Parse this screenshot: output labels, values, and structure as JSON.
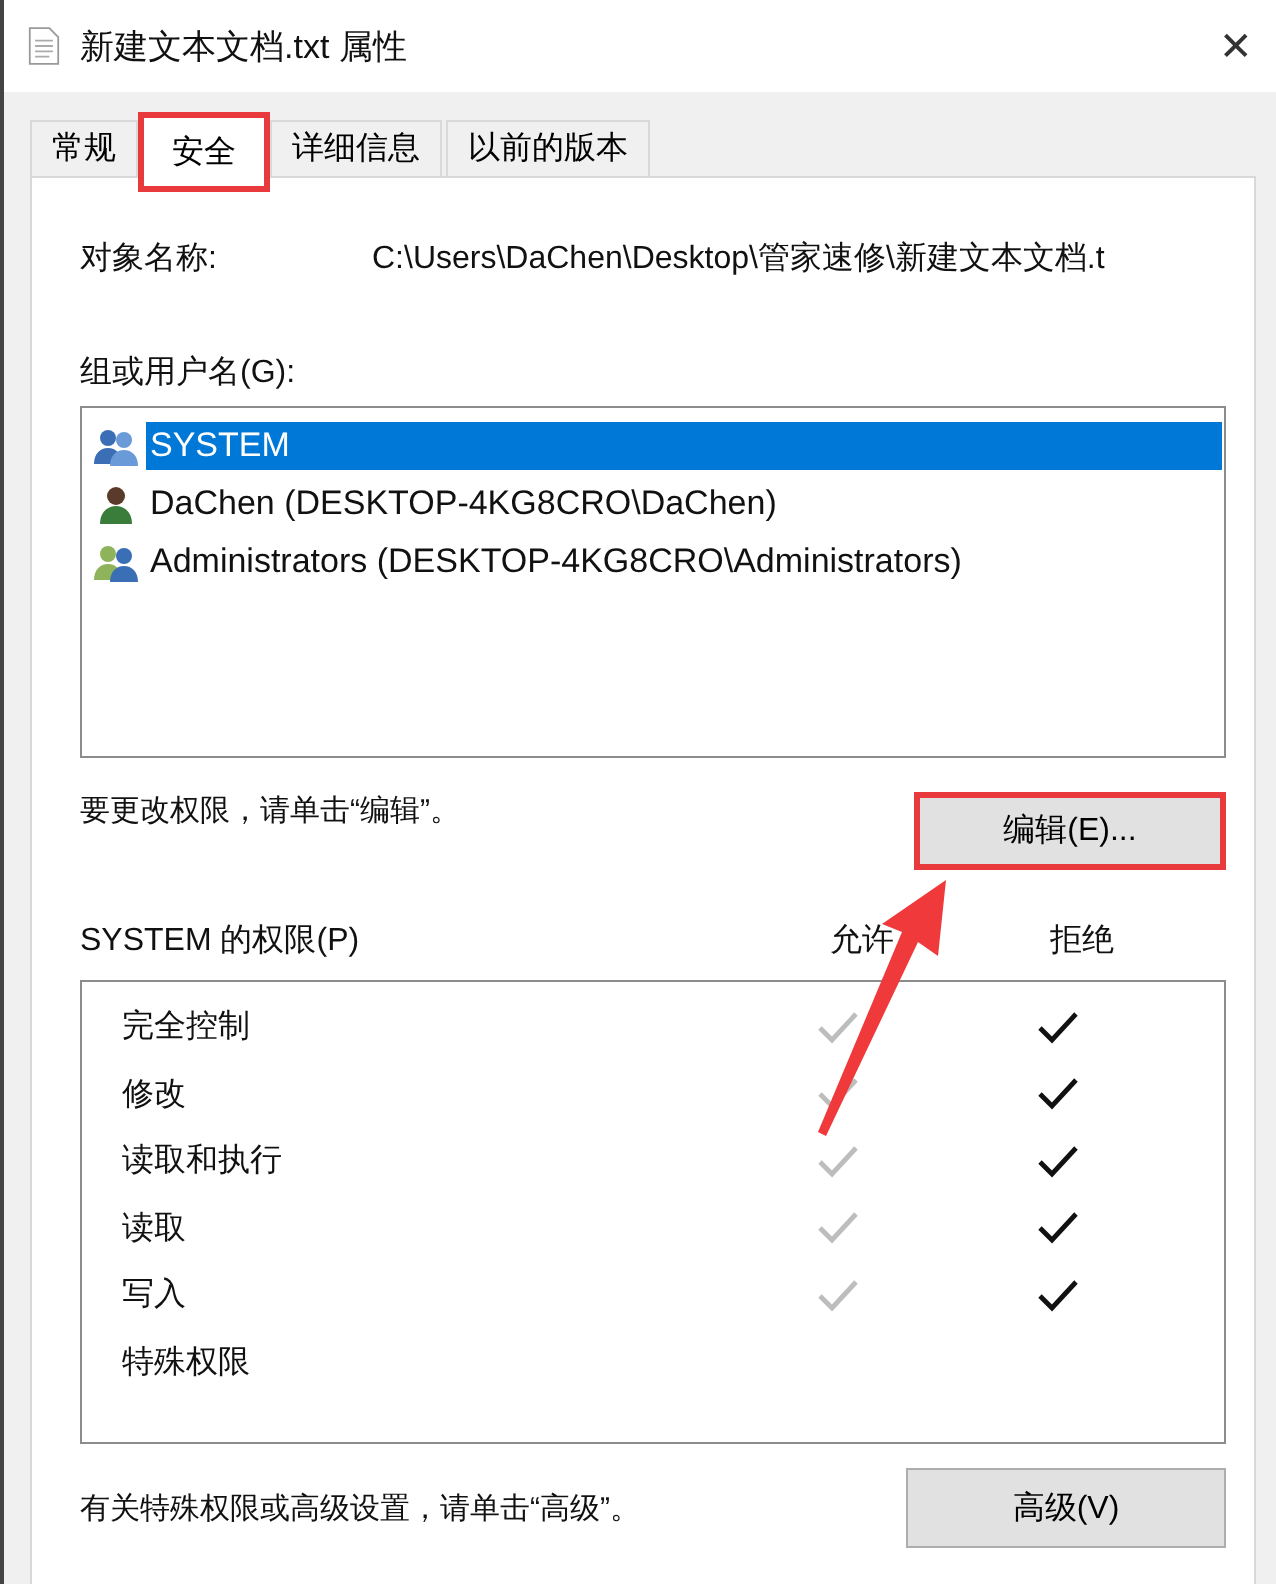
{
  "window": {
    "title": "新建文本文档.txt 属性",
    "close": "✕"
  },
  "tabs": [
    {
      "label": "常规",
      "selected": false,
      "highlighted": false
    },
    {
      "label": "安全",
      "selected": true,
      "highlighted": true
    },
    {
      "label": "详细信息",
      "selected": false,
      "highlighted": false
    },
    {
      "label": "以前的版本",
      "selected": false,
      "highlighted": false
    }
  ],
  "object_name": {
    "label": "对象名称:",
    "value": "C:\\Users\\DaChen\\Desktop\\管家速修\\新建文本文档.t"
  },
  "groups": {
    "label": "组或用户名(G):",
    "items": [
      {
        "name": "SYSTEM",
        "kind": "group",
        "selected": true
      },
      {
        "name": "DaChen (DESKTOP-4KG8CRO\\DaChen)",
        "kind": "user",
        "selected": false
      },
      {
        "name": "Administrators (DESKTOP-4KG8CRO\\Administrators)",
        "kind": "group-mixed",
        "selected": false
      }
    ]
  },
  "edit_hint": "要更改权限，请单击“编辑”。",
  "edit_button": {
    "label": "编辑(E)...",
    "highlighted": true
  },
  "permissions": {
    "label": "SYSTEM 的权限(P)",
    "allow_heading": "允许",
    "deny_heading": "拒绝",
    "rows": [
      {
        "name": "完全控制",
        "allow": true,
        "allow_disabled": true,
        "deny": true
      },
      {
        "name": "修改",
        "allow": true,
        "allow_disabled": true,
        "deny": true
      },
      {
        "name": "读取和执行",
        "allow": true,
        "allow_disabled": true,
        "deny": true
      },
      {
        "name": "读取",
        "allow": true,
        "allow_disabled": true,
        "deny": true
      },
      {
        "name": "写入",
        "allow": true,
        "allow_disabled": true,
        "deny": true
      },
      {
        "name": "特殊权限",
        "allow": false,
        "deny": false
      }
    ]
  },
  "advanced_hint": "有关特殊权限或高级设置，请单击“高级”。",
  "advanced_button": {
    "label": "高级(V)"
  }
}
